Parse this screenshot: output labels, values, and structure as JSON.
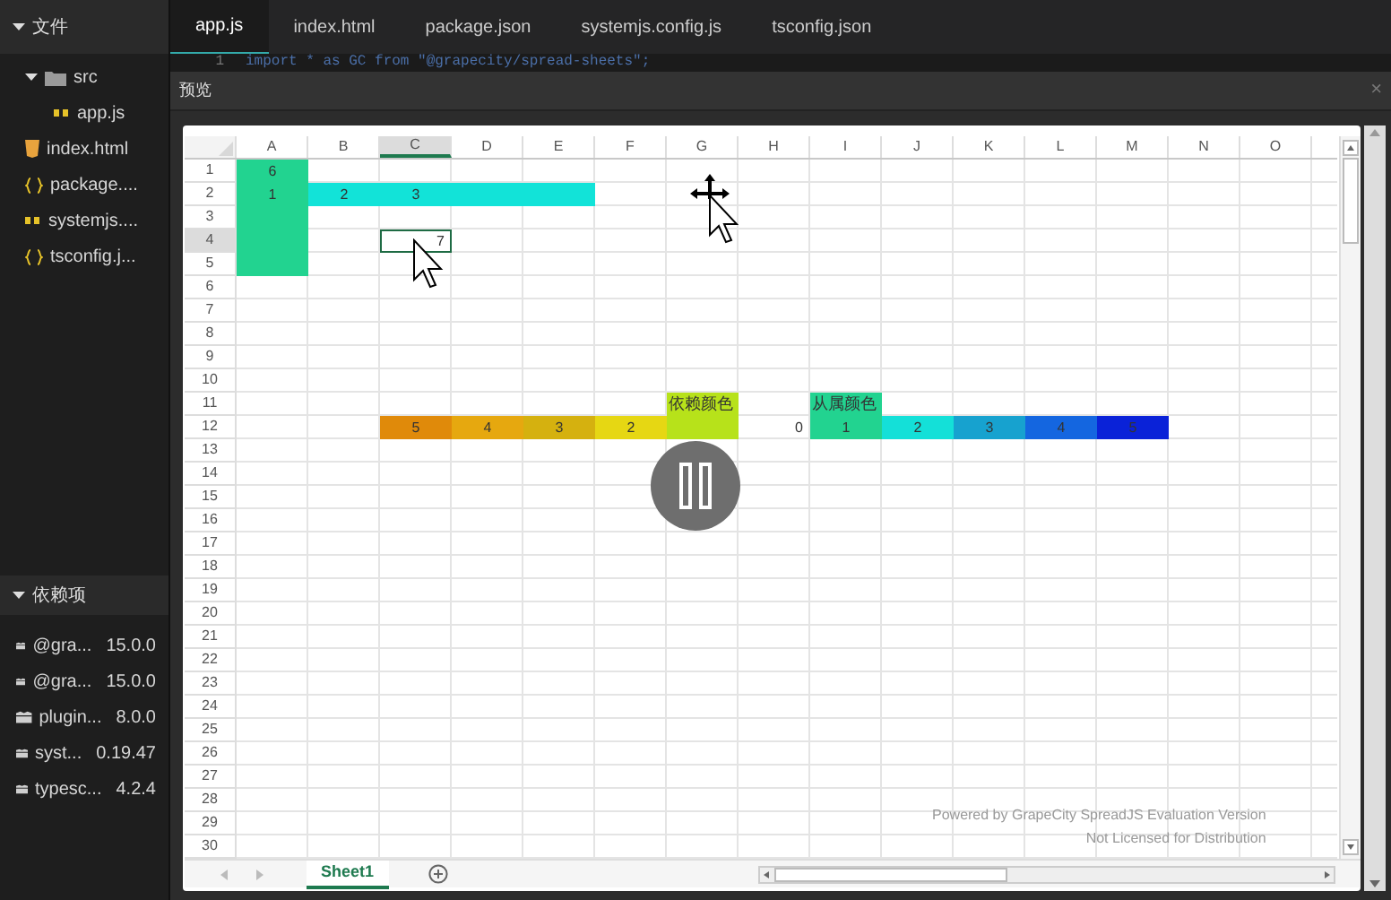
{
  "sidebar": {
    "files_header": {
      "label": "文件",
      "expanded": true
    },
    "tree": [
      {
        "label": "src",
        "kind": "folder",
        "expanded": true,
        "children": [
          {
            "label": "app.js",
            "kind": "js"
          }
        ]
      },
      {
        "label": "index.html",
        "kind": "html"
      },
      {
        "label": "package....",
        "kind": "json"
      },
      {
        "label": "systemjs....",
        "kind": "js"
      },
      {
        "label": "tsconfig.j...",
        "kind": "json"
      }
    ],
    "deps_header": {
      "label": "依赖项",
      "expanded": true
    },
    "dependencies": [
      {
        "name": "@gra...",
        "version": "15.0.0"
      },
      {
        "name": "@gra...",
        "version": "15.0.0"
      },
      {
        "name": "plugin...",
        "version": "8.0.0"
      },
      {
        "name": "syst...",
        "version": "0.19.47"
      },
      {
        "name": "typesc...",
        "version": "4.2.4"
      }
    ]
  },
  "tabs": [
    {
      "label": "app.js",
      "selected": true
    },
    {
      "label": "index.html",
      "selected": false
    },
    {
      "label": "package.json",
      "selected": false
    },
    {
      "label": "systemjs.config.js",
      "selected": false
    },
    {
      "label": "tsconfig.json",
      "selected": false
    }
  ],
  "code": {
    "line_number": "1",
    "text": "import * as GC from \"@grapecity/spread-sheets\";"
  },
  "preview": {
    "title": "预览",
    "close": "×",
    "sheet": {
      "columns": [
        {
          "label": "A",
          "selected": false
        },
        {
          "label": "B",
          "selected": false
        },
        {
          "label": "C",
          "selected": true
        },
        {
          "label": "D",
          "selected": false
        },
        {
          "label": "E",
          "selected": false
        },
        {
          "label": "F",
          "selected": false
        },
        {
          "label": "G",
          "selected": false
        },
        {
          "label": "H",
          "selected": false
        },
        {
          "label": "I",
          "selected": false
        },
        {
          "label": "J",
          "selected": false
        },
        {
          "label": "K",
          "selected": false
        },
        {
          "label": "L",
          "selected": false
        },
        {
          "label": "M",
          "selected": false
        },
        {
          "label": "N",
          "selected": false
        },
        {
          "label": "O",
          "selected": false
        }
      ],
      "rows": [
        {
          "label": "1",
          "selected": false,
          "cells": {
            "A": {
              "text": "6",
              "color": "#22d390"
            }
          }
        },
        {
          "label": "2",
          "selected": false,
          "cells": {
            "A": {
              "text": "1",
              "color": "#22d390"
            },
            "B": {
              "text": "2",
              "color": "#12e3d8"
            },
            "C": {
              "text": "3",
              "color": "#12e3d8"
            },
            "D": {
              "color": "#12e3d8"
            },
            "E": {
              "color": "#12e3d8"
            }
          }
        },
        {
          "label": "3",
          "selected": false,
          "cells": {
            "A": {
              "color": "#22d390"
            }
          }
        },
        {
          "label": "4",
          "selected": true,
          "cells": {
            "A": {
              "color": "#22d390"
            },
            "C": {
              "text": "7"
            }
          }
        },
        {
          "label": "5",
          "selected": false,
          "cells": {
            "A": {
              "color": "#22d390"
            }
          }
        },
        {
          "label": "6",
          "selected": false,
          "cells": {}
        },
        {
          "label": "7",
          "selected": false,
          "cells": {}
        },
        {
          "label": "8",
          "selected": false,
          "cells": {}
        },
        {
          "label": "9",
          "selected": false,
          "cells": {}
        },
        {
          "label": "10",
          "selected": false,
          "cells": {}
        },
        {
          "label": "11",
          "selected": false,
          "cells": {
            "G": {
              "text": "依赖颜色",
              "color": "#b7e21a"
            },
            "I": {
              "text": "从属颜色",
              "color": "#22d390"
            }
          }
        },
        {
          "label": "12",
          "selected": false,
          "cells": {
            "C": {
              "text": "5",
              "color": "#e08a0a"
            },
            "D": {
              "text": "4",
              "color": "#e6a80f"
            },
            "E": {
              "text": "3",
              "color": "#d5b10f"
            },
            "F": {
              "text": "2",
              "color": "#e6d713"
            },
            "G": {
              "color": "#b7e21a"
            },
            "H": {
              "text": "0"
            },
            "I": {
              "text": "1",
              "color": "#22d390"
            },
            "J": {
              "text": "2",
              "color": "#14e0d8"
            },
            "K": {
              "text": "3",
              "color": "#17a2cf"
            },
            "L": {
              "text": "4",
              "color": "#1466e0"
            },
            "M": {
              "text": "5",
              "color": "#0a22d8"
            }
          }
        },
        {
          "label": "13",
          "selected": false,
          "cells": {}
        },
        {
          "label": "14",
          "selected": false,
          "cells": {}
        },
        {
          "label": "15",
          "selected": false,
          "cells": {}
        },
        {
          "label": "16",
          "selected": false,
          "cells": {}
        },
        {
          "label": "17",
          "selected": false,
          "cells": {}
        },
        {
          "label": "18",
          "selected": false,
          "cells": {}
        },
        {
          "label": "19",
          "selected": false,
          "cells": {}
        },
        {
          "label": "20",
          "selected": false,
          "cells": {}
        },
        {
          "label": "21",
          "selected": false,
          "cells": {}
        },
        {
          "label": "22",
          "selected": false,
          "cells": {}
        },
        {
          "label": "23",
          "selected": false,
          "cells": {}
        },
        {
          "label": "24",
          "selected": false,
          "cells": {}
        },
        {
          "label": "25",
          "selected": false,
          "cells": {}
        },
        {
          "label": "26",
          "selected": false,
          "cells": {}
        },
        {
          "label": "27",
          "selected": false,
          "cells": {}
        },
        {
          "label": "28",
          "selected": false,
          "cells": {}
        },
        {
          "label": "29",
          "selected": false,
          "cells": {}
        },
        {
          "label": "30",
          "selected": false,
          "cells": {}
        }
      ],
      "watermark_lines": [
        "Powered by GrapeCity SpreadJS Evaluation Version",
        "Not Licensed for Distribution"
      ],
      "sheet_tabs": [
        {
          "label": "Sheet1",
          "selected": true
        }
      ]
    }
  }
}
